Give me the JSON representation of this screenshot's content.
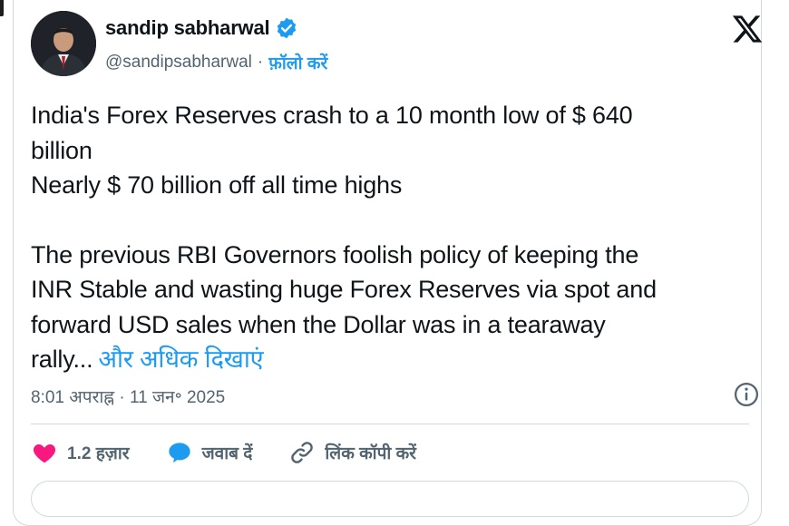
{
  "author": {
    "name": "sandip sabharwal",
    "handle": "@sandipsabharwal",
    "separator": "·",
    "follow_label": "फ़ॉलो करें"
  },
  "tweet": {
    "line1": "India's Forex Reserves crash to a 10 month low of $ 640",
    "line2": "billion",
    "line3": "Nearly $ 70 billion off all time highs",
    "line4": "The previous RBI Governors foolish policy of keeping the",
    "line5": "INR Stable and wasting huge Forex Reserves via spot and",
    "line6": "forward USD sales when the Dollar was in a tearaway",
    "line7": "rally...",
    "show_more": "और अधिक दिखाएं"
  },
  "meta": {
    "timestamp": "8:01 अपराह्न · 11 जन॰ 2025"
  },
  "actions": {
    "like_count": "1.2 हज़ार",
    "reply_label": "जवाब दें",
    "copy_link_label": "लिंक कॉपी करें"
  },
  "colors": {
    "accent": "#1d9bf0",
    "like": "#f91880",
    "muted": "#536471",
    "text": "#0f1419",
    "border": "#cfd9de"
  },
  "icons": [
    "verified-badge-icon",
    "x-logo-icon",
    "info-icon",
    "heart-icon",
    "reply-bubble-icon",
    "link-icon"
  ]
}
